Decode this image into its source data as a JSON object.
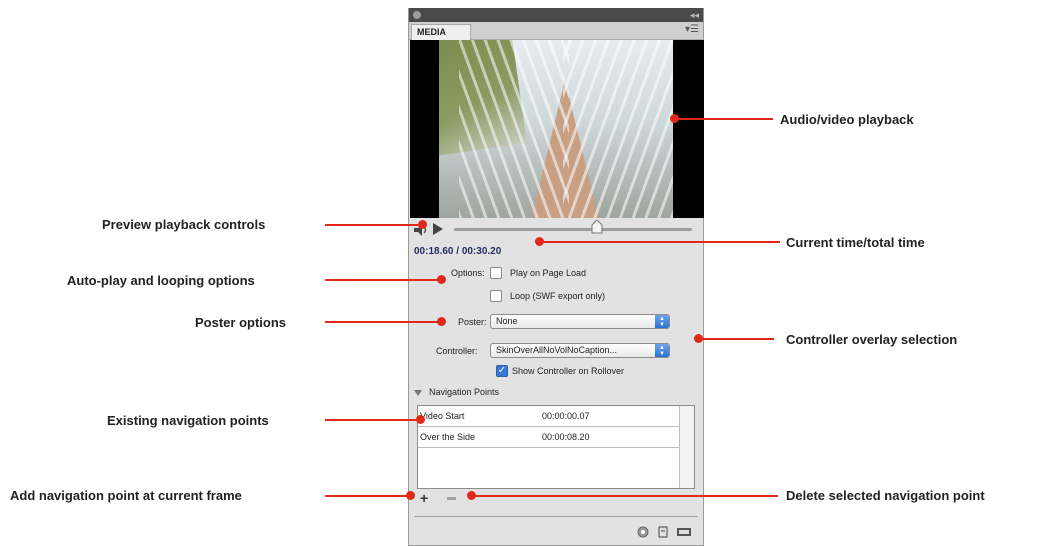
{
  "panel": {
    "tab_label": "MEDIA",
    "timecode": "00:18.60 / 00:30.20",
    "options_label": "Options:",
    "play_on_load_label": "Play on Page Load",
    "loop_label": "Loop (SWF export only)",
    "poster_label": "Poster:",
    "poster_value": "None",
    "controller_label": "Controller:",
    "controller_value": "SkinOverAllNoVolNoCaption...",
    "show_controller_label": "Show Controller on Rollover",
    "show_controller_checked": true,
    "play_on_load_checked": false,
    "loop_checked": false,
    "scrub_position": 0.67,
    "nav_header": "Navigation Points",
    "nav_points": [
      {
        "name": "Video Start",
        "time": "00:00:00.07"
      },
      {
        "name": "Over the Side",
        "time": "00:00:08.20"
      }
    ]
  },
  "callouts": {
    "audio_video": "Audio/video playback",
    "preview_controls": "Preview playback controls",
    "current_total": "Current time/total time",
    "autoplay_looping": "Auto-play and looping options",
    "poster_options": "Poster options",
    "controller_overlay": "Controller overlay selection",
    "existing_nav": "Existing navigation points",
    "add_nav": "Add navigation point at current frame",
    "delete_nav": "Delete selected navigation point"
  },
  "colors": {
    "callout_red": "#e0291b",
    "timecode_blue": "#1f2f5a",
    "checkbox_blue": "#3b77d4"
  }
}
